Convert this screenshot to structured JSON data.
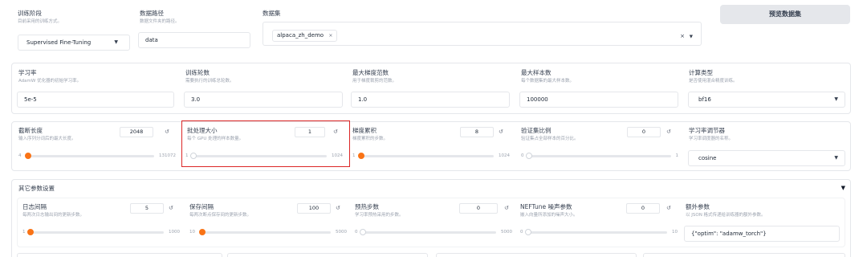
{
  "top": {
    "stage": {
      "label": "训练阶段",
      "info": "目前采用的训练方式。",
      "value": "Supervised Fine-Tuning"
    },
    "dataset_dir": {
      "label": "数据路径",
      "info": "数据文件夹的路径。",
      "value": "data"
    },
    "dataset": {
      "label": "数据集",
      "tag": "alpaca_zh_demo",
      "tag_remove": "×",
      "clear": "×"
    },
    "preview_button": "预览数据集"
  },
  "row1": {
    "learning_rate": {
      "label": "学习率",
      "info": "AdamW 优化器的初始学习率。",
      "value": "5e-5"
    },
    "num_epochs": {
      "label": "训练轮数",
      "info": "需要执行的训练总轮数。",
      "value": "3.0"
    },
    "max_grad_norm": {
      "label": "最大梯度范数",
      "info": "用于梯度裁剪的范数。",
      "value": "1.0"
    },
    "max_samples": {
      "label": "最大样本数",
      "info": "每个数据集的最大样本数。",
      "value": "100000"
    },
    "compute_type": {
      "label": "计算类型",
      "info": "是否使用混合精度训练。",
      "value": "bf16"
    }
  },
  "row2": {
    "cutoff_len": {
      "label": "截断长度",
      "info": "输入序列分词后的最大长度。",
      "value": "2048",
      "min": "4",
      "max": "131072",
      "level": 0.016
    },
    "batch_size": {
      "label": "批处理大小",
      "info": "每个 GPU 处理的样本数量。",
      "value": "1",
      "min": "1",
      "max": "1024",
      "level": 0.0
    },
    "grad_accum": {
      "label": "梯度累积",
      "info": "梯度累积的步数。",
      "value": "8",
      "min": "1",
      "max": "1024",
      "level": 0.007
    },
    "val_size": {
      "label": "验证集比例",
      "info": "验证集占全部样本的百分比。",
      "value": "0",
      "min": "0",
      "max": "1",
      "level": 0.0
    },
    "lr_scheduler": {
      "label": "学习率调节器",
      "info": "学习率调度器的名称。",
      "value": "cosine"
    }
  },
  "other": {
    "title": "其它参数设置",
    "logging_steps": {
      "label": "日志间隔",
      "info": "每两次日志输出间的更新步数。",
      "value": "5",
      "min": "1",
      "max": "1000",
      "level": 0.004
    },
    "save_steps": {
      "label": "保存间隔",
      "info": "每两次断点保存间的更新步数。",
      "value": "100",
      "min": "10",
      "max": "5000",
      "level": 0.018
    },
    "warmup_steps": {
      "label": "预热步数",
      "info": "学习率预热采用的步数。",
      "value": "0",
      "min": "0",
      "max": "5000",
      "level": 0.0
    },
    "neftune_alpha": {
      "label": "NEFTune 噪声参数",
      "info": "嵌入向量所添加的噪声大小。",
      "value": "0",
      "min": "0",
      "max": "10",
      "level": 0.0
    },
    "extra_args": {
      "label": "额外参数",
      "info": "以 JSON 格式传递给训练器的额外参数。",
      "value": "{\"optim\": \"adamw_torch\"}"
    }
  },
  "icons": {
    "reset": "↺",
    "dropdown": "▼",
    "collapse": "▼"
  },
  "colors": {
    "accent": "#f97316",
    "highlight_border": "#dc2626",
    "button_bg": "#e5e7eb"
  }
}
